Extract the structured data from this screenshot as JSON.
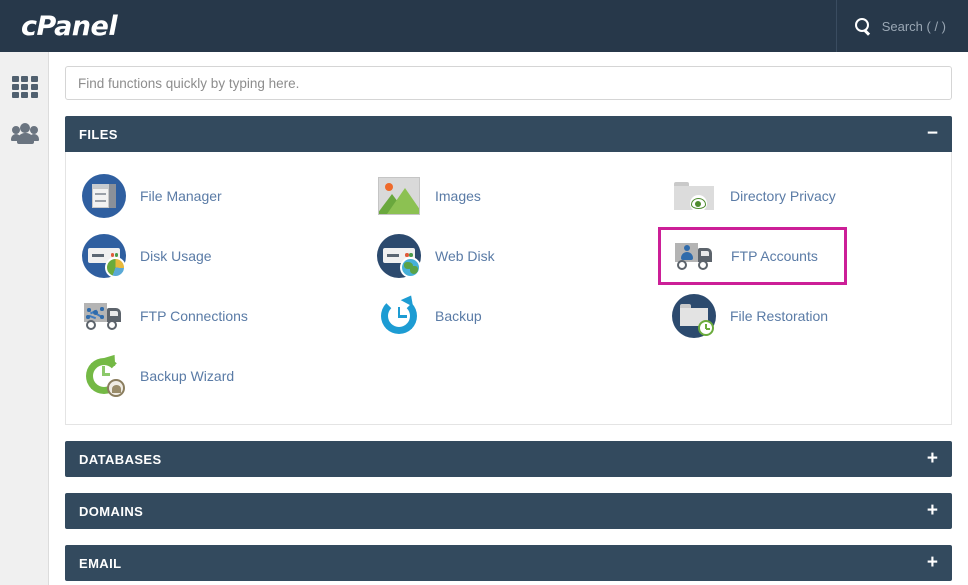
{
  "header": {
    "logo_text": "cPanel",
    "search_label": "Search ( / )",
    "search_icon": "search-icon"
  },
  "sidebar": {
    "items": [
      {
        "icon": "grid-apps-icon",
        "name": "apps"
      },
      {
        "icon": "users-group-icon",
        "name": "user-manager"
      }
    ]
  },
  "search": {
    "value": "",
    "placeholder": "Find functions quickly by typing here."
  },
  "colors": {
    "topbar": "#27384a",
    "panel_header": "#334a5e",
    "link": "#5a7ba6",
    "highlight": "#cc1f97",
    "sidebar": "#f0f0f0"
  },
  "panels": [
    {
      "title": "FILES",
      "expanded": true,
      "toggle": "−",
      "toggle_name": "collapse-icon",
      "tiles": [
        {
          "label": "File Manager",
          "icon": "file-manager-icon",
          "highlighted": false
        },
        {
          "label": "Images",
          "icon": "images-icon",
          "highlighted": false
        },
        {
          "label": "Directory Privacy",
          "icon": "directory-privacy-icon",
          "highlighted": false
        },
        {
          "label": "Disk Usage",
          "icon": "disk-usage-icon",
          "highlighted": false
        },
        {
          "label": "Web Disk",
          "icon": "web-disk-icon",
          "highlighted": false
        },
        {
          "label": "FTP Accounts",
          "icon": "ftp-accounts-icon",
          "highlighted": true
        },
        {
          "label": "FTP Connections",
          "icon": "ftp-connections-icon",
          "highlighted": false
        },
        {
          "label": "Backup",
          "icon": "backup-icon",
          "highlighted": false
        },
        {
          "label": "File Restoration",
          "icon": "file-restoration-icon",
          "highlighted": false
        },
        {
          "label": "Backup Wizard",
          "icon": "backup-wizard-icon",
          "highlighted": false
        }
      ]
    },
    {
      "title": "DATABASES",
      "expanded": false,
      "toggle": "+",
      "toggle_name": "expand-icon",
      "tiles": []
    },
    {
      "title": "DOMAINS",
      "expanded": false,
      "toggle": "+",
      "toggle_name": "expand-icon",
      "tiles": []
    },
    {
      "title": "EMAIL",
      "expanded": false,
      "toggle": "+",
      "toggle_name": "expand-icon",
      "tiles": []
    }
  ]
}
